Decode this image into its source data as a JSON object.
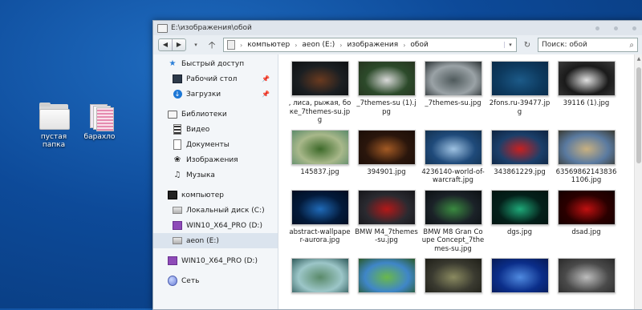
{
  "desktop": {
    "icons": [
      {
        "label": "пустая папка",
        "icon": "folder-icon"
      },
      {
        "label": "барахло",
        "icon": "documents-icon"
      }
    ]
  },
  "window": {
    "title": "E:\\изображения\\обой",
    "address": {
      "segments": [
        "компьютер",
        "aeon (E:)",
        "изображения",
        "обой"
      ],
      "separator": "›"
    },
    "search_placeholder": "Поиск: обой",
    "nav_glyphs": {
      "back": "◀",
      "forward": "▶",
      "dropdown": "▾",
      "up": "🡡",
      "refresh": "↻",
      "search": "⌕"
    }
  },
  "sidebar": {
    "items": [
      {
        "label": "Быстрый доступ",
        "icon": "star-icon"
      },
      {
        "label": "Рабочий стол",
        "icon": "desktop-icon",
        "pinned": true
      },
      {
        "label": "Загрузки",
        "icon": "downloads-icon",
        "pinned": true
      },
      {
        "label": "Библиотеки",
        "icon": "libraries-icon"
      },
      {
        "label": "Видео",
        "icon": "video-icon"
      },
      {
        "label": "Документы",
        "icon": "documents-icon"
      },
      {
        "label": "Изображения",
        "icon": "pictures-icon"
      },
      {
        "label": "Музыка",
        "icon": "music-icon"
      },
      {
        "label": "компьютер",
        "icon": "computer-icon"
      },
      {
        "label": "Локальный диск (C:)",
        "icon": "hdd-icon"
      },
      {
        "label": "WIN10_X64_PRO (D:)",
        "icon": "windows-disc-icon"
      },
      {
        "label": "aeon (E:)",
        "icon": "hdd-icon",
        "selected": true
      },
      {
        "label": "WIN10_X64_PRO (D:)",
        "icon": "windows-disc-icon"
      },
      {
        "label": "Сеть",
        "icon": "network-icon"
      }
    ]
  },
  "files": [
    {
      "name": ", лиса, рыжая, боке_7themes-su.jpg",
      "colors": [
        "#1b1f22",
        "#6a3a1f",
        "#0d1012"
      ]
    },
    {
      "name": "_7themes-su (1).jpg",
      "colors": [
        "#2c4a2a",
        "#d9d9d9",
        "#26331f"
      ]
    },
    {
      "name": "_7themes-su.jpg",
      "colors": [
        "#9aa2a6",
        "#4f5a5c",
        "#2b3234"
      ]
    },
    {
      "name": "2fons.ru-39477.jpg",
      "colors": [
        "#0d3a5f",
        "#1c5a88",
        "#0a2a48"
      ]
    },
    {
      "name": "39116 (1).jpg",
      "colors": [
        "#1a1a1a",
        "#e0e0e0",
        "#3b3b3b"
      ]
    },
    {
      "name": "145837.jpg",
      "colors": [
        "#a8b88a",
        "#3e6a2a",
        "#5b8a6a"
      ]
    },
    {
      "name": "394901.jpg",
      "colors": [
        "#2a160c",
        "#a35a24",
        "#1b0e08"
      ]
    },
    {
      "name": "4236140-world-of-warcraft.jpg",
      "colors": [
        "#1f4a7a",
        "#9ec2e2",
        "#13314f"
      ]
    },
    {
      "name": "343861229.jpg",
      "colors": [
        "#1b3f6a",
        "#c82020",
        "#0e2340"
      ]
    },
    {
      "name": "635698621438361106.jpg",
      "colors": [
        "#5a7aa0",
        "#c8b080",
        "#3a3a32"
      ]
    },
    {
      "name": "abstract-wallpaper-aurora.jpg",
      "colors": [
        "#031a3a",
        "#1f6ab8",
        "#020c1e"
      ]
    },
    {
      "name": "BMW M4_7themes-su.jpg",
      "colors": [
        "#2a2a30",
        "#b41818",
        "#16161a"
      ]
    },
    {
      "name": "BMW M8 Gran Coupe Concept_7themes-su.jpg",
      "colors": [
        "#1b2228",
        "#3a8a40",
        "#0c1013"
      ]
    },
    {
      "name": "dgs.jpg",
      "colors": [
        "#04201a",
        "#1ea878",
        "#021410"
      ]
    },
    {
      "name": "dsad.jpg",
      "colors": [
        "#2a0000",
        "#c01010",
        "#140000"
      ]
    },
    {
      "name": "",
      "colors": [
        "#9cc6c8",
        "#5a8a6a",
        "#2f5a5a"
      ]
    },
    {
      "name": "",
      "colors": [
        "#3f86c8",
        "#6ab84a",
        "#2a5a2a"
      ]
    },
    {
      "name": "",
      "colors": [
        "#3a3a30",
        "#8a8a60",
        "#1f1f18"
      ]
    },
    {
      "name": "",
      "colors": [
        "#0b2e8a",
        "#4f8ae0",
        "#061a55"
      ]
    },
    {
      "name": "",
      "colors": [
        "#4a4a4a",
        "#bdbdbd",
        "#2a2a2a"
      ]
    }
  ]
}
